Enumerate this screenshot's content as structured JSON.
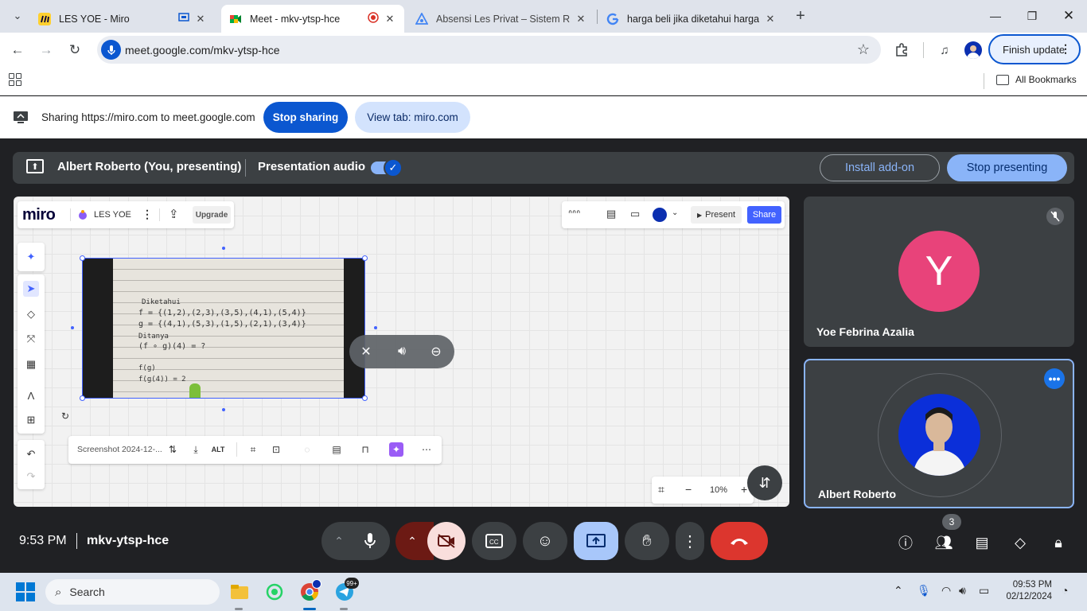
{
  "browser": {
    "tabs": [
      {
        "title": "LES YOE - Miro",
        "favicon": "miro-favicon"
      },
      {
        "title": "Meet - mkv-ytsp-hce",
        "favicon": "google-meet-favicon",
        "active": true
      },
      {
        "title": "Absensi Les Privat – Sistem Rua",
        "favicon": "app-favicon"
      },
      {
        "title": "harga beli jika diketahui harga j",
        "favicon": "google-favicon"
      }
    ],
    "url": "meet.google.com/mkv-ytsp-hce",
    "finish_update_label": "Finish update",
    "all_bookmarks_label": "All Bookmarks"
  },
  "sharing_bar": {
    "text": "Sharing https://miro.com to meet.google.com",
    "stop_sharing_label": "Stop sharing",
    "view_tab_label": "View tab: miro.com"
  },
  "presenting_bar": {
    "presenter_text": "Albert Roberto (You, presenting)",
    "audio_label": "Presentation audio",
    "audio_on": true,
    "install_addon_label": "Install add-on",
    "stop_presenting_label": "Stop presenting"
  },
  "miro": {
    "logo": "miro",
    "board_name": "LES YOE",
    "upgrade_label": "Upgrade",
    "present_label": "Present",
    "share_label": "Share",
    "image_name": "Screenshot 2024-12-...",
    "alt_label": "ALT",
    "zoom": "10%",
    "handwriting": [
      "Diketahui",
      "f = {(1,2),(2,3),(3,5),(4,1),(5,4)}",
      "g = {(4,1),(5,3),(1,5),(2,1),(3,4)}",
      "Ditanya",
      "(f ∘ g)(4) = ?",
      "f(g)",
      "f(g(4)) = 2"
    ]
  },
  "participants": [
    {
      "name": "Yoe Febrina Azalia",
      "initial": "Y",
      "avatar_color": "#e8437a",
      "muted": true
    },
    {
      "name": "Albert Roberto",
      "speaking": true
    }
  ],
  "meet_controls": {
    "time": "9:53 PM",
    "meeting_code": "mkv-ytsp-hce",
    "people_count": "3"
  },
  "taskbar": {
    "search_placeholder": "Search",
    "telegram_badge": "99+",
    "clock_time": "09:53 PM",
    "clock_date": "02/12/2024"
  }
}
